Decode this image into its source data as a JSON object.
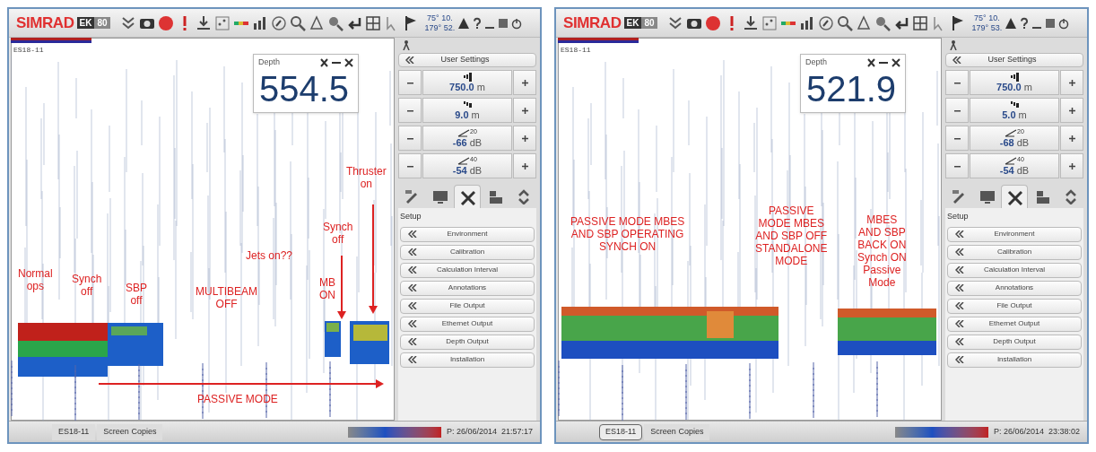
{
  "screens": [
    {
      "brand": "SIMRAD",
      "model": [
        "EK",
        "80"
      ],
      "position": [
        "75° 10.",
        "179° 52."
      ],
      "channel": "ES18-11",
      "depth": {
        "label": "Depth",
        "value": "554.5"
      },
      "user_settings": "User Settings",
      "adjusters": [
        {
          "kind": "range",
          "value": "750.0",
          "unit": "m"
        },
        {
          "kind": "start",
          "value": "9.0",
          "unit": "m"
        },
        {
          "kind": "tvg",
          "sup": "20",
          "value": "-66",
          "unit": "dB"
        },
        {
          "kind": "tvg",
          "sup": "40",
          "value": "-54",
          "unit": "dB"
        }
      ],
      "tabs": [
        {
          "selected": false
        },
        {
          "selected": false
        },
        {
          "selected": true
        },
        {
          "selected": false
        },
        {
          "selected": false
        }
      ],
      "setup_heading": "Setup",
      "setup_items": [
        "Environment",
        "Calibration",
        "Calculation Interval",
        "Annotations",
        "File Output",
        "Ethernet Output",
        "Depth Output",
        "Installation"
      ],
      "bottom_tabs": [
        {
          "label": "ES18-11",
          "selected": false
        },
        {
          "label": "Screen Copies",
          "selected": false
        }
      ],
      "status": "P: 26/06/2014  21:57:17",
      "annotations": [
        "Normal\nops",
        "Synch\noff",
        "SBP\noff",
        "MULTIBEAM\nOFF",
        "Jets on??",
        "MB\nON",
        "Synch\noff",
        "Thruster\non",
        "PASSIVE MODE"
      ]
    },
    {
      "brand": "SIMRAD",
      "model": [
        "EK",
        "80"
      ],
      "position": [
        "75° 10.",
        "179° 53."
      ],
      "channel": "ES18-11",
      "depth": {
        "label": "Depth",
        "value": "521.9"
      },
      "user_settings": "User Settings",
      "adjusters": [
        {
          "kind": "range",
          "value": "750.0",
          "unit": "m"
        },
        {
          "kind": "start",
          "value": "5.0",
          "unit": "m"
        },
        {
          "kind": "tvg",
          "sup": "20",
          "value": "-68",
          "unit": "dB"
        },
        {
          "kind": "tvg",
          "sup": "40",
          "value": "-54",
          "unit": "dB"
        }
      ],
      "tabs": [
        {
          "selected": false
        },
        {
          "selected": false
        },
        {
          "selected": true
        },
        {
          "selected": false
        },
        {
          "selected": false
        }
      ],
      "setup_heading": "Setup",
      "setup_items": [
        "Environment",
        "Calibration",
        "Calculation Interval",
        "Annotations",
        "File Output",
        "Ethernet Output",
        "Depth Output",
        "Installation"
      ],
      "bottom_tabs": [
        {
          "label": "ES18-11",
          "selected": true
        },
        {
          "label": "Screen Copies",
          "selected": false
        }
      ],
      "status": "P: 26/06/2014  23:38:02",
      "annotations": [
        "PASSIVE MODE MBES\nAND SBP OPERATING\nSYNCH ON",
        "PASSIVE\nMODE MBES\nAND SBP OFF\nSTANDALONE\nMODE",
        "MBES\nAND SBP\nBACK ON\nSynch ON\nPassive\nMode"
      ]
    }
  ]
}
